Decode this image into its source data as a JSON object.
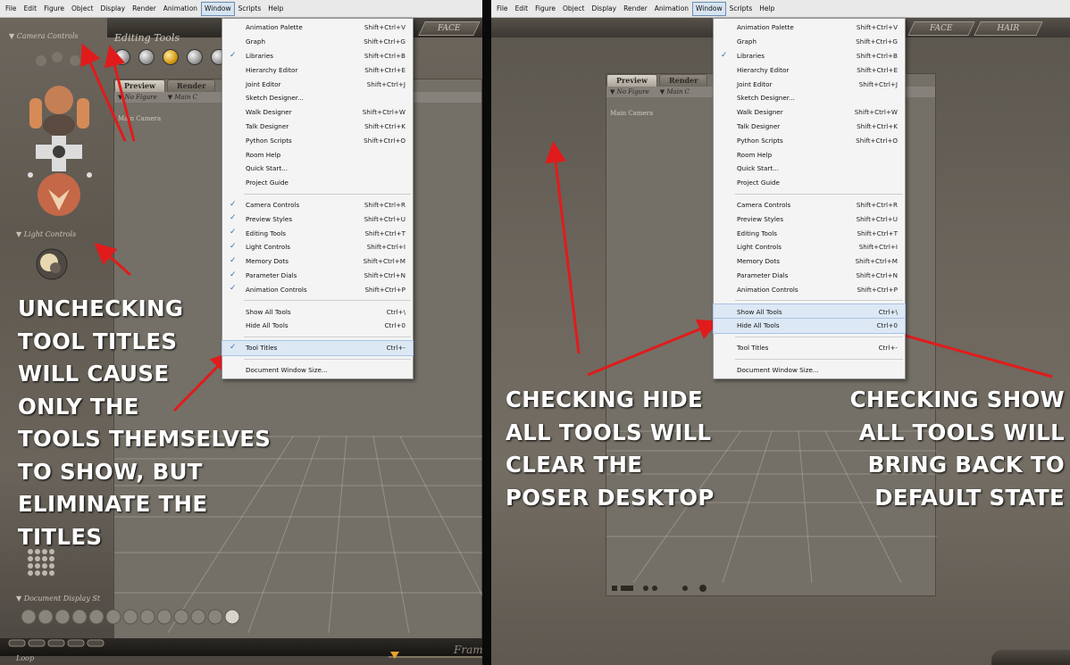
{
  "menubar": {
    "items": [
      "File",
      "Edit",
      "Figure",
      "Object",
      "Display",
      "Render",
      "Animation",
      "Window",
      "Scripts",
      "Help"
    ],
    "active": "Window"
  },
  "menu_left": [
    {
      "label": "Animation Palette",
      "shortcut": "Shift+Ctrl+V",
      "checked": false
    },
    {
      "label": "Graph",
      "shortcut": "Shift+Ctrl+G",
      "checked": false
    },
    {
      "label": "Libraries",
      "shortcut": "Shift+Ctrl+B",
      "checked": true
    },
    {
      "label": "Hierarchy Editor",
      "shortcut": "Shift+Ctrl+E",
      "checked": false
    },
    {
      "label": "Joint Editor",
      "shortcut": "Shift+Ctrl+J",
      "checked": false
    },
    {
      "label": "Sketch Designer...",
      "shortcut": "",
      "checked": false
    },
    {
      "label": "Walk Designer",
      "shortcut": "Shift+Ctrl+W",
      "checked": false
    },
    {
      "label": "Talk Designer",
      "shortcut": "Shift+Ctrl+K",
      "checked": false
    },
    {
      "label": "Python Scripts",
      "shortcut": "Shift+Ctrl+O",
      "checked": false
    },
    {
      "label": "Room Help",
      "shortcut": "",
      "checked": false
    },
    {
      "label": "Quick Start...",
      "shortcut": "",
      "checked": false
    },
    {
      "label": "Project Guide",
      "shortcut": "",
      "checked": false
    },
    {
      "sep": true
    },
    {
      "label": "Camera Controls",
      "shortcut": "Shift+Ctrl+R",
      "checked": true
    },
    {
      "label": "Preview Styles",
      "shortcut": "Shift+Ctrl+U",
      "checked": true
    },
    {
      "label": "Editing Tools",
      "shortcut": "Shift+Ctrl+T",
      "checked": true
    },
    {
      "label": "Light Controls",
      "shortcut": "Shift+Ctrl+I",
      "checked": true
    },
    {
      "label": "Memory Dots",
      "shortcut": "Shift+Ctrl+M",
      "checked": true
    },
    {
      "label": "Parameter Dials",
      "shortcut": "Shift+Ctrl+N",
      "checked": true
    },
    {
      "label": "Animation Controls",
      "shortcut": "Shift+Ctrl+P",
      "checked": true
    },
    {
      "sep": true
    },
    {
      "label": "Show All Tools",
      "shortcut": "Ctrl+\\",
      "checked": false
    },
    {
      "label": "Hide All Tools",
      "shortcut": "Ctrl+0",
      "checked": false
    },
    {
      "sep": true
    },
    {
      "label": "Tool Titles",
      "shortcut": "Ctrl+-",
      "checked": true,
      "highlight": true
    },
    {
      "sep": true
    },
    {
      "label": "Document Window Size...",
      "shortcut": "",
      "checked": false
    }
  ],
  "menu_right": [
    {
      "label": "Animation Palette",
      "shortcut": "Shift+Ctrl+V",
      "checked": false
    },
    {
      "label": "Graph",
      "shortcut": "Shift+Ctrl+G",
      "checked": false
    },
    {
      "label": "Libraries",
      "shortcut": "Shift+Ctrl+B",
      "checked": true
    },
    {
      "label": "Hierarchy Editor",
      "shortcut": "Shift+Ctrl+E",
      "checked": false
    },
    {
      "label": "Joint Editor",
      "shortcut": "Shift+Ctrl+J",
      "checked": false
    },
    {
      "label": "Sketch Designer...",
      "shortcut": "",
      "checked": false
    },
    {
      "label": "Walk Designer",
      "shortcut": "Shift+Ctrl+W",
      "checked": false
    },
    {
      "label": "Talk Designer",
      "shortcut": "Shift+Ctrl+K",
      "checked": false
    },
    {
      "label": "Python Scripts",
      "shortcut": "Shift+Ctrl+O",
      "checked": false
    },
    {
      "label": "Room Help",
      "shortcut": "",
      "checked": false
    },
    {
      "label": "Quick Start...",
      "shortcut": "",
      "checked": false
    },
    {
      "label": "Project Guide",
      "shortcut": "",
      "checked": false
    },
    {
      "sep": true
    },
    {
      "label": "Camera Controls",
      "shortcut": "Shift+Ctrl+R",
      "checked": false
    },
    {
      "label": "Preview Styles",
      "shortcut": "Shift+Ctrl+U",
      "checked": false
    },
    {
      "label": "Editing Tools",
      "shortcut": "Shift+Ctrl+T",
      "checked": false
    },
    {
      "label": "Light Controls",
      "shortcut": "Shift+Ctrl+I",
      "checked": false
    },
    {
      "label": "Memory Dots",
      "shortcut": "Shift+Ctrl+M",
      "checked": false
    },
    {
      "label": "Parameter Dials",
      "shortcut": "Shift+Ctrl+N",
      "checked": false
    },
    {
      "label": "Animation Controls",
      "shortcut": "Shift+Ctrl+P",
      "checked": false
    },
    {
      "sep": true
    },
    {
      "label": "Show All Tools",
      "shortcut": "Ctrl+\\",
      "checked": false,
      "highlight": true
    },
    {
      "label": "Hide All Tools",
      "shortcut": "Ctrl+0",
      "checked": false,
      "highlight": true
    },
    {
      "sep": true
    },
    {
      "label": "Tool Titles",
      "shortcut": "Ctrl+-",
      "checked": false
    },
    {
      "sep": true
    },
    {
      "label": "Document Window Size...",
      "shortcut": "",
      "checked": false
    }
  ],
  "left_panel": {
    "camera_controls_title": "▼ Camera Controls",
    "editing_tools_title": "Editing Tools",
    "light_controls_title": "▼ Light Controls",
    "document_display_title": "▼ Document Display St",
    "frame_label": "Fram",
    "loop_label": "Loop",
    "tabs": [
      "Preview",
      "Render"
    ],
    "figure_row": [
      "▼ No Figure",
      "▼ Main C"
    ],
    "camera_label": "Main Camera",
    "annotation": [
      "UNCHECKING",
      "TOOL TITLES",
      "WILL CAUSE",
      "ONLY THE",
      "TOOLS THEMSELVES",
      "TO SHOW, BUT",
      "ELIMINATE THE",
      "TITLES"
    ]
  },
  "right_panel": {
    "tabs": [
      "Preview",
      "Render"
    ],
    "figure_row": [
      "▼ No Figure",
      "▼ Main C"
    ],
    "camera_label": "Main Camera",
    "room_tabs": [
      "FACE",
      "HAIR"
    ],
    "annotation_left": [
      "CHECKING HIDE",
      "ALL TOOLS WILL",
      "CLEAR THE",
      "POSER DESKTOP"
    ],
    "annotation_right": [
      "CHECKING SHOW",
      "ALL TOOLS WILL",
      "BRING BACK TO",
      "DEFAULT STATE"
    ]
  },
  "left_face_tab": "FACE",
  "colors": {
    "arrow": "#e11b1b",
    "menu_bg": "#f4f4f4",
    "check": "#3a6fb0"
  }
}
